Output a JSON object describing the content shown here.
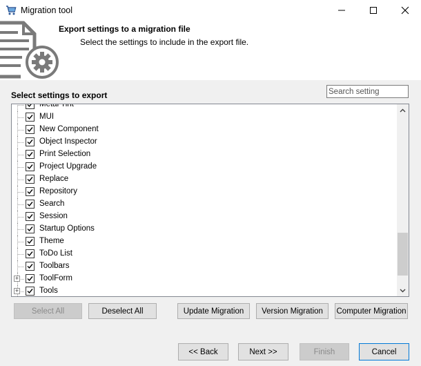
{
  "window": {
    "title": "Migration tool"
  },
  "header": {
    "title": "Export settings to a migration file",
    "subtitle": "Select the settings to include in the export file."
  },
  "settings_panel": {
    "label": "Select settings to export",
    "search_placeholder": "Search setting",
    "items": [
      {
        "label": "Metal Tint",
        "checked": true,
        "expandable": false
      },
      {
        "label": "MUI",
        "checked": true,
        "expandable": false
      },
      {
        "label": "New Component",
        "checked": true,
        "expandable": false
      },
      {
        "label": "Object Inspector",
        "checked": true,
        "expandable": false
      },
      {
        "label": "Print Selection",
        "checked": true,
        "expandable": false
      },
      {
        "label": "Project Upgrade",
        "checked": true,
        "expandable": false
      },
      {
        "label": "Replace",
        "checked": true,
        "expandable": false
      },
      {
        "label": "Repository",
        "checked": true,
        "expandable": false
      },
      {
        "label": "Search",
        "checked": true,
        "expandable": false
      },
      {
        "label": "Session",
        "checked": true,
        "expandable": false
      },
      {
        "label": "Startup Options",
        "checked": true,
        "expandable": false
      },
      {
        "label": "Theme",
        "checked": true,
        "expandable": false
      },
      {
        "label": "ToDo List",
        "checked": true,
        "expandable": false
      },
      {
        "label": "Toolbars",
        "checked": true,
        "expandable": false
      },
      {
        "label": "ToolForm",
        "checked": true,
        "expandable": true
      },
      {
        "label": "Tools",
        "checked": true,
        "expandable": true
      }
    ]
  },
  "actions": {
    "select_all": "Select All",
    "deselect_all": "Deselect All",
    "update_migration": "Update Migration",
    "version_migration": "Version Migration",
    "computer_migration": "Computer Migration"
  },
  "nav": {
    "back": "<< Back",
    "next": "Next >>",
    "finish": "Finish",
    "cancel": "Cancel"
  },
  "icons": {
    "app": "shopping-cart-icon",
    "header": "document-gear-icon"
  }
}
